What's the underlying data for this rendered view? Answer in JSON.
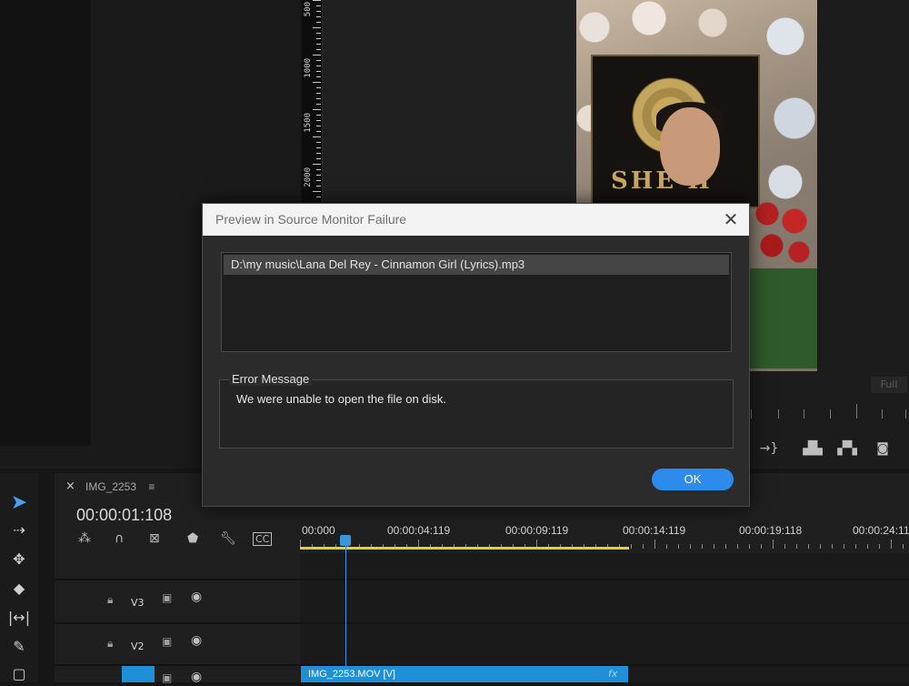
{
  "ruler": {
    "labels": [
      "500",
      "1000",
      "1500",
      "2000"
    ]
  },
  "program_monitor": {
    "sign_text": "SHE    H",
    "zoom_label": "Full"
  },
  "dialog": {
    "title": "Preview in Source Monitor Failure",
    "close_glyph": "✕",
    "file_path": "D:\\my music\\Lana Del Rey - Cinnamon Girl (Lyrics).mp3",
    "error_heading": "Error Message",
    "error_text": "We were unable to open the file on disk.",
    "ok_label": "OK",
    "accent_color": "#2d8ceb"
  },
  "timeline": {
    "sequence_name": "IMG_2253",
    "close_glyph": "×",
    "menu_glyph": "≡",
    "timecode": "00:00:01:108",
    "ruler_times": [
      "00:000",
      "00:00:04:119",
      "00:00:09:119",
      "00:00:14:119",
      "00:00:19:118",
      "00:00:24:11"
    ],
    "tracks": [
      {
        "name": "V3"
      },
      {
        "name": "V2"
      }
    ],
    "clip": {
      "label": "IMG_2253.MOV [V]",
      "fx": "fx"
    },
    "workarea_color": "#e3d22b",
    "playhead_color": "#3a95dd"
  },
  "icons": {
    "selection_tool": "selection-arrow-icon",
    "track_select": "track-select-forward-icon",
    "ripple_edit": "ripple-edit-icon",
    "razor": "razor-icon",
    "slip": "slip-icon",
    "pen": "pen-icon",
    "rectangle": "rectangle-icon",
    "snap": "snap-magnet-icon",
    "linked": "linked-selection-icon",
    "marker": "add-marker-icon",
    "wrench": "wrench-icon",
    "captions": "captions-icon",
    "insert": "insert-icon",
    "lift": "lift-icon",
    "extract": "extract-icon",
    "export_frame": "camera-icon"
  }
}
